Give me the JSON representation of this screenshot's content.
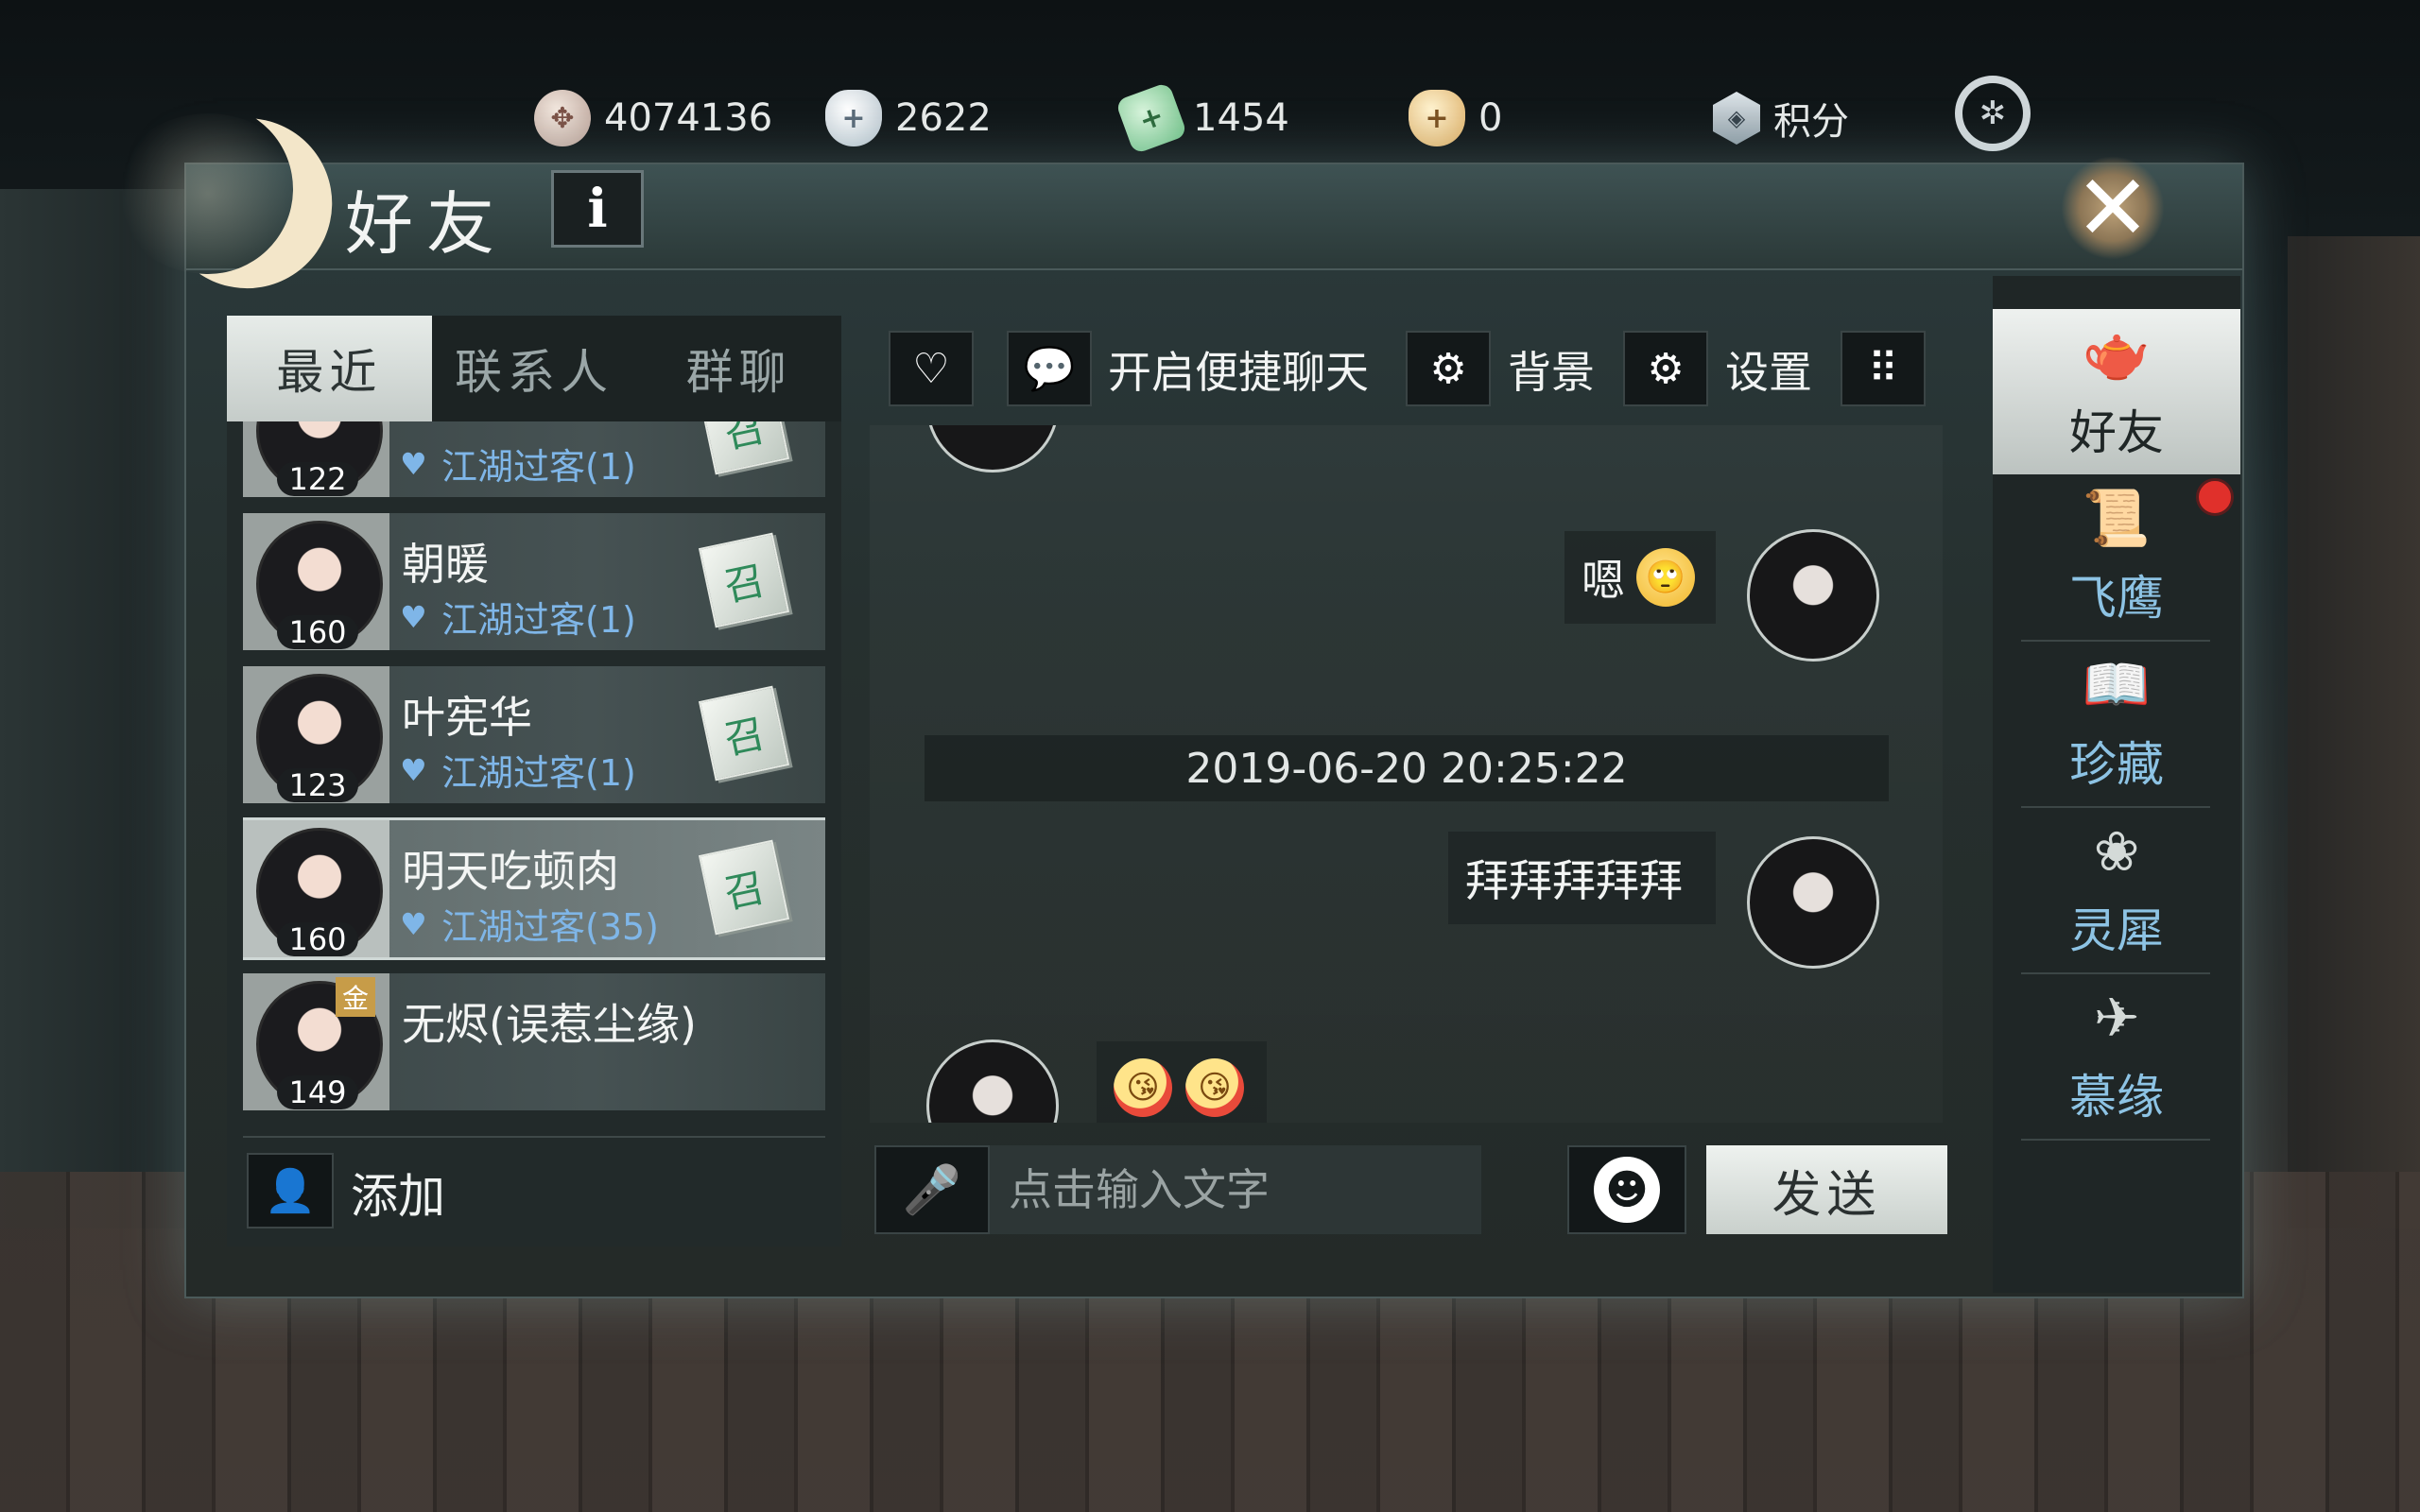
{
  "currencies": [
    {
      "icon": "copper-coin-icon",
      "value": "4074136"
    },
    {
      "icon": "silver-ingot-icon",
      "value": "2622"
    },
    {
      "icon": "jade-icon",
      "value": "1454"
    },
    {
      "icon": "gold-ingot-icon",
      "value": "0"
    },
    {
      "icon": "score-shield-icon",
      "value": "积分"
    }
  ],
  "panel": {
    "title": "好友",
    "info_label": "i",
    "close_label": "✕"
  },
  "tabs": [
    {
      "label": "最近",
      "active": true
    },
    {
      "label": "联系人",
      "active": false
    },
    {
      "label": "群聊",
      "active": false
    }
  ],
  "friends": [
    {
      "name": "",
      "level": "122",
      "relation": "江湖过客(1)",
      "summon": "召",
      "partial": true
    },
    {
      "name": "朝暖",
      "level": "160",
      "relation": "江湖过客(1)",
      "summon": "召"
    },
    {
      "name": "叶宪华",
      "level": "123",
      "relation": "江湖过客(1)",
      "summon": "召"
    },
    {
      "name": "明天吃顿肉",
      "level": "160",
      "relation": "江湖过客(35)",
      "summon": "召",
      "selected": true
    },
    {
      "name": "无烬(误惹尘缘)",
      "level": "149",
      "badge": "金"
    }
  ],
  "add": {
    "label": "添加"
  },
  "toolbar": {
    "quick_chat_label": "开启便捷聊天",
    "background_label": "背景",
    "settings_label": "设置"
  },
  "chat": {
    "messages": [
      {
        "side": "right",
        "text": "嗯",
        "emoji": "🙄"
      },
      {
        "side": "right",
        "text": "拜拜拜拜拜"
      },
      {
        "side": "left",
        "emoji_count": 2
      }
    ],
    "timestamp": "2019-06-20 20:25:22"
  },
  "input": {
    "placeholder": "点击输入文字",
    "send_label": "发送"
  },
  "nav": [
    {
      "label": "好友",
      "icon": "teapot-icon",
      "active": true
    },
    {
      "label": "飞鹰",
      "icon": "scroll-icon"
    },
    {
      "label": "珍藏",
      "icon": "book-icon"
    },
    {
      "label": "灵犀",
      "icon": "charm-icon"
    },
    {
      "label": "慕缘",
      "icon": "paper-crane-icon"
    }
  ]
}
